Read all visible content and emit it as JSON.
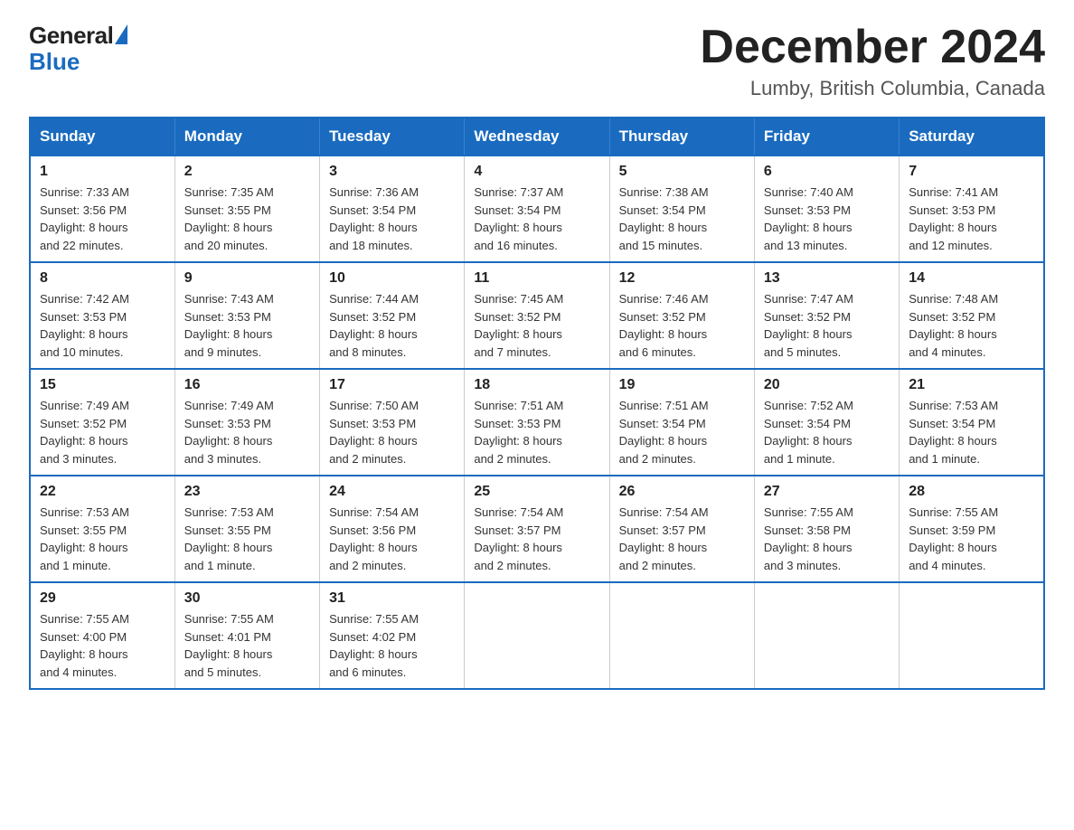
{
  "logo": {
    "general": "General",
    "blue": "Blue"
  },
  "header": {
    "month_year": "December 2024",
    "location": "Lumby, British Columbia, Canada"
  },
  "weekdays": [
    "Sunday",
    "Monday",
    "Tuesday",
    "Wednesday",
    "Thursday",
    "Friday",
    "Saturday"
  ],
  "weeks": [
    [
      {
        "day": "1",
        "sunrise": "7:33 AM",
        "sunset": "3:56 PM",
        "daylight": "8 hours and 22 minutes."
      },
      {
        "day": "2",
        "sunrise": "7:35 AM",
        "sunset": "3:55 PM",
        "daylight": "8 hours and 20 minutes."
      },
      {
        "day": "3",
        "sunrise": "7:36 AM",
        "sunset": "3:54 PM",
        "daylight": "8 hours and 18 minutes."
      },
      {
        "day": "4",
        "sunrise": "7:37 AM",
        "sunset": "3:54 PM",
        "daylight": "8 hours and 16 minutes."
      },
      {
        "day": "5",
        "sunrise": "7:38 AM",
        "sunset": "3:54 PM",
        "daylight": "8 hours and 15 minutes."
      },
      {
        "day": "6",
        "sunrise": "7:40 AM",
        "sunset": "3:53 PM",
        "daylight": "8 hours and 13 minutes."
      },
      {
        "day": "7",
        "sunrise": "7:41 AM",
        "sunset": "3:53 PM",
        "daylight": "8 hours and 12 minutes."
      }
    ],
    [
      {
        "day": "8",
        "sunrise": "7:42 AM",
        "sunset": "3:53 PM",
        "daylight": "8 hours and 10 minutes."
      },
      {
        "day": "9",
        "sunrise": "7:43 AM",
        "sunset": "3:53 PM",
        "daylight": "8 hours and 9 minutes."
      },
      {
        "day": "10",
        "sunrise": "7:44 AM",
        "sunset": "3:52 PM",
        "daylight": "8 hours and 8 minutes."
      },
      {
        "day": "11",
        "sunrise": "7:45 AM",
        "sunset": "3:52 PM",
        "daylight": "8 hours and 7 minutes."
      },
      {
        "day": "12",
        "sunrise": "7:46 AM",
        "sunset": "3:52 PM",
        "daylight": "8 hours and 6 minutes."
      },
      {
        "day": "13",
        "sunrise": "7:47 AM",
        "sunset": "3:52 PM",
        "daylight": "8 hours and 5 minutes."
      },
      {
        "day": "14",
        "sunrise": "7:48 AM",
        "sunset": "3:52 PM",
        "daylight": "8 hours and 4 minutes."
      }
    ],
    [
      {
        "day": "15",
        "sunrise": "7:49 AM",
        "sunset": "3:52 PM",
        "daylight": "8 hours and 3 minutes."
      },
      {
        "day": "16",
        "sunrise": "7:49 AM",
        "sunset": "3:53 PM",
        "daylight": "8 hours and 3 minutes."
      },
      {
        "day": "17",
        "sunrise": "7:50 AM",
        "sunset": "3:53 PM",
        "daylight": "8 hours and 2 minutes."
      },
      {
        "day": "18",
        "sunrise": "7:51 AM",
        "sunset": "3:53 PM",
        "daylight": "8 hours and 2 minutes."
      },
      {
        "day": "19",
        "sunrise": "7:51 AM",
        "sunset": "3:54 PM",
        "daylight": "8 hours and 2 minutes."
      },
      {
        "day": "20",
        "sunrise": "7:52 AM",
        "sunset": "3:54 PM",
        "daylight": "8 hours and 1 minute."
      },
      {
        "day": "21",
        "sunrise": "7:53 AM",
        "sunset": "3:54 PM",
        "daylight": "8 hours and 1 minute."
      }
    ],
    [
      {
        "day": "22",
        "sunrise": "7:53 AM",
        "sunset": "3:55 PM",
        "daylight": "8 hours and 1 minute."
      },
      {
        "day": "23",
        "sunrise": "7:53 AM",
        "sunset": "3:55 PM",
        "daylight": "8 hours and 1 minute."
      },
      {
        "day": "24",
        "sunrise": "7:54 AM",
        "sunset": "3:56 PM",
        "daylight": "8 hours and 2 minutes."
      },
      {
        "day": "25",
        "sunrise": "7:54 AM",
        "sunset": "3:57 PM",
        "daylight": "8 hours and 2 minutes."
      },
      {
        "day": "26",
        "sunrise": "7:54 AM",
        "sunset": "3:57 PM",
        "daylight": "8 hours and 2 minutes."
      },
      {
        "day": "27",
        "sunrise": "7:55 AM",
        "sunset": "3:58 PM",
        "daylight": "8 hours and 3 minutes."
      },
      {
        "day": "28",
        "sunrise": "7:55 AM",
        "sunset": "3:59 PM",
        "daylight": "8 hours and 4 minutes."
      }
    ],
    [
      {
        "day": "29",
        "sunrise": "7:55 AM",
        "sunset": "4:00 PM",
        "daylight": "8 hours and 4 minutes."
      },
      {
        "day": "30",
        "sunrise": "7:55 AM",
        "sunset": "4:01 PM",
        "daylight": "8 hours and 5 minutes."
      },
      {
        "day": "31",
        "sunrise": "7:55 AM",
        "sunset": "4:02 PM",
        "daylight": "8 hours and 6 minutes."
      },
      null,
      null,
      null,
      null
    ]
  ],
  "labels": {
    "sunrise": "Sunrise:",
    "sunset": "Sunset:",
    "daylight": "Daylight:"
  }
}
